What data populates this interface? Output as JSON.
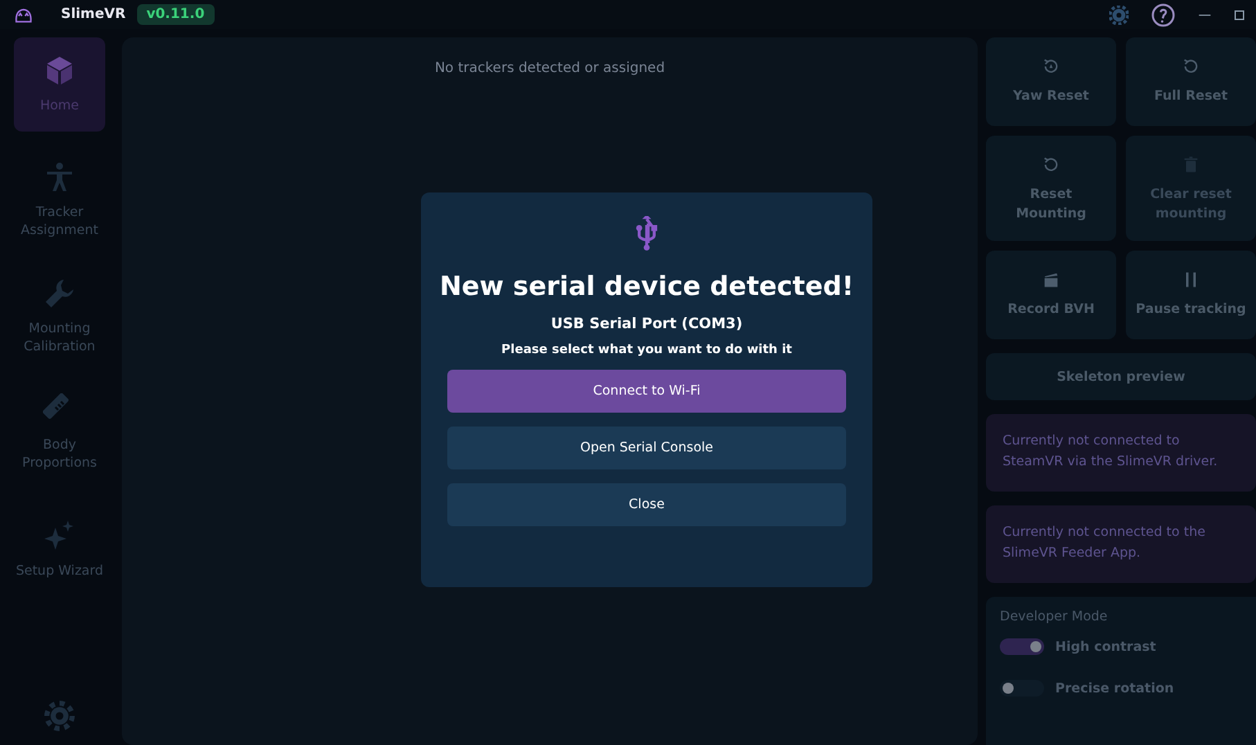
{
  "title_bar": {
    "app_name": "SlimeVR",
    "version": "v0.11.0"
  },
  "sidebar": {
    "items": [
      {
        "label": "Home",
        "selected": true
      },
      {
        "label": "Tracker Assignment",
        "selected": false
      },
      {
        "label": "Mounting Calibration",
        "selected": false
      },
      {
        "label": "Body Proportions",
        "selected": false
      },
      {
        "label": "Setup Wizard",
        "selected": false
      }
    ]
  },
  "main": {
    "message": "No trackers detected or assigned"
  },
  "right_panel": {
    "actions": [
      {
        "label": "Yaw Reset",
        "disabled": false
      },
      {
        "label": "Full Reset",
        "disabled": false
      },
      {
        "label": "Reset Mounting",
        "disabled": false
      },
      {
        "label": "Clear reset mounting",
        "disabled": true
      },
      {
        "label": "Record BVH",
        "disabled": false
      },
      {
        "label": "Pause tracking",
        "disabled": false
      }
    ],
    "skeleton_button": "Skeleton preview",
    "warnings": [
      "Currently not connected to SteamVR via the SlimeVR driver.",
      "Currently not connected to the SlimeVR Feeder App."
    ],
    "developer": {
      "title": "Developer Mode",
      "toggles": [
        {
          "label": "High contrast",
          "on": true
        },
        {
          "label": "Precise rotation",
          "on": false
        }
      ]
    }
  },
  "dialog": {
    "title": "New serial device detected!",
    "device": "USB Serial Port (COM3)",
    "prompt": "Please select what you want to do with it",
    "buttons": [
      {
        "label": "Connect to Wi-Fi",
        "kind": "primary"
      },
      {
        "label": "Open Serial Console",
        "kind": "secondary"
      },
      {
        "label": "Close",
        "kind": "secondary"
      }
    ]
  }
}
